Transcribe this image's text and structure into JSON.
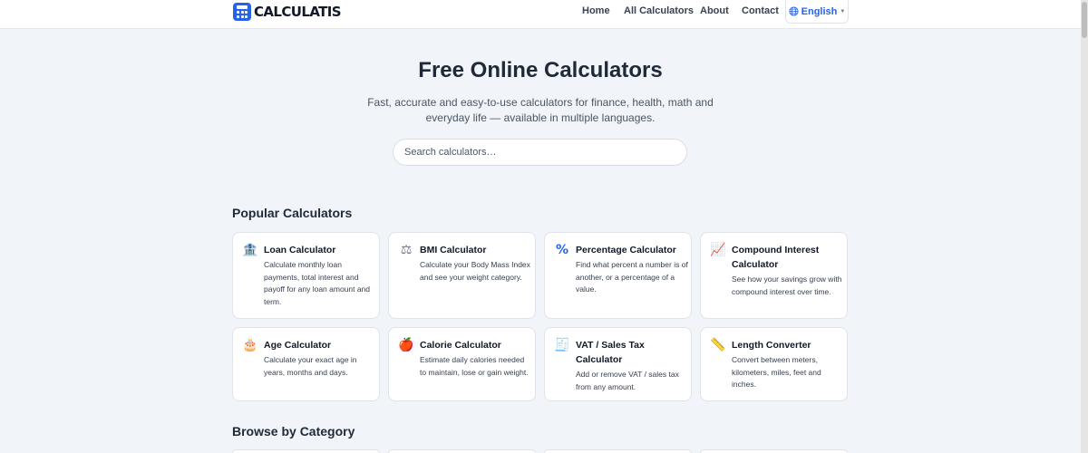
{
  "header": {
    "brand": "CALCULATIS",
    "nav": [
      {
        "label": "Home"
      },
      {
        "label": "All Calculators"
      },
      {
        "label": "About"
      },
      {
        "label": "Contact"
      }
    ],
    "language": "English",
    "language_icon": "globe-icon",
    "accent_color": "#2563eb"
  },
  "hero": {
    "title": "Free Online Calculators",
    "subtitle": "Fast, accurate and easy-to-use calculators for finance, health, math and everyday life — available in multiple languages.",
    "search_placeholder": "Search calculators…"
  },
  "popular": {
    "heading": "Popular Calculators",
    "cards": [
      {
        "icon": "bank-icon",
        "glyph": "🏦",
        "title": "Loan Calculator",
        "desc": "Calculate monthly loan payments, total interest and payoff for any loan amount and term."
      },
      {
        "icon": "scales-icon",
        "glyph": "⚖",
        "title": "BMI Calculator",
        "desc": "Calculate your Body Mass Index and see your weight category."
      },
      {
        "icon": "percent-icon",
        "glyph": "%",
        "title": "Percentage Calculator",
        "desc": "Find what percent a number is of another, or a percentage of a value."
      },
      {
        "icon": "chart-increasing-icon",
        "glyph": "📈",
        "title": "Compound Interest Calculator",
        "desc": "See how your savings grow with compound interest over time."
      },
      {
        "icon": "birthday-cake-icon",
        "glyph": "🎂",
        "title": "Age Calculator",
        "desc": "Calculate your exact age in years, months and days."
      },
      {
        "icon": "apple-icon",
        "glyph": "🍎",
        "title": "Calorie Calculator",
        "desc": "Estimate daily calories needed to maintain, lose or gain weight."
      },
      {
        "icon": "receipt-icon",
        "glyph": "🧾",
        "title": "VAT / Sales Tax Calculator",
        "desc": "Add or remove VAT / sales tax from any amount."
      },
      {
        "icon": "ruler-icon",
        "glyph": "📏",
        "title": "Length Converter",
        "desc": "Convert between meters, kilometers, miles, feet and inches."
      }
    ]
  },
  "browse": {
    "heading": "Browse by Category"
  }
}
